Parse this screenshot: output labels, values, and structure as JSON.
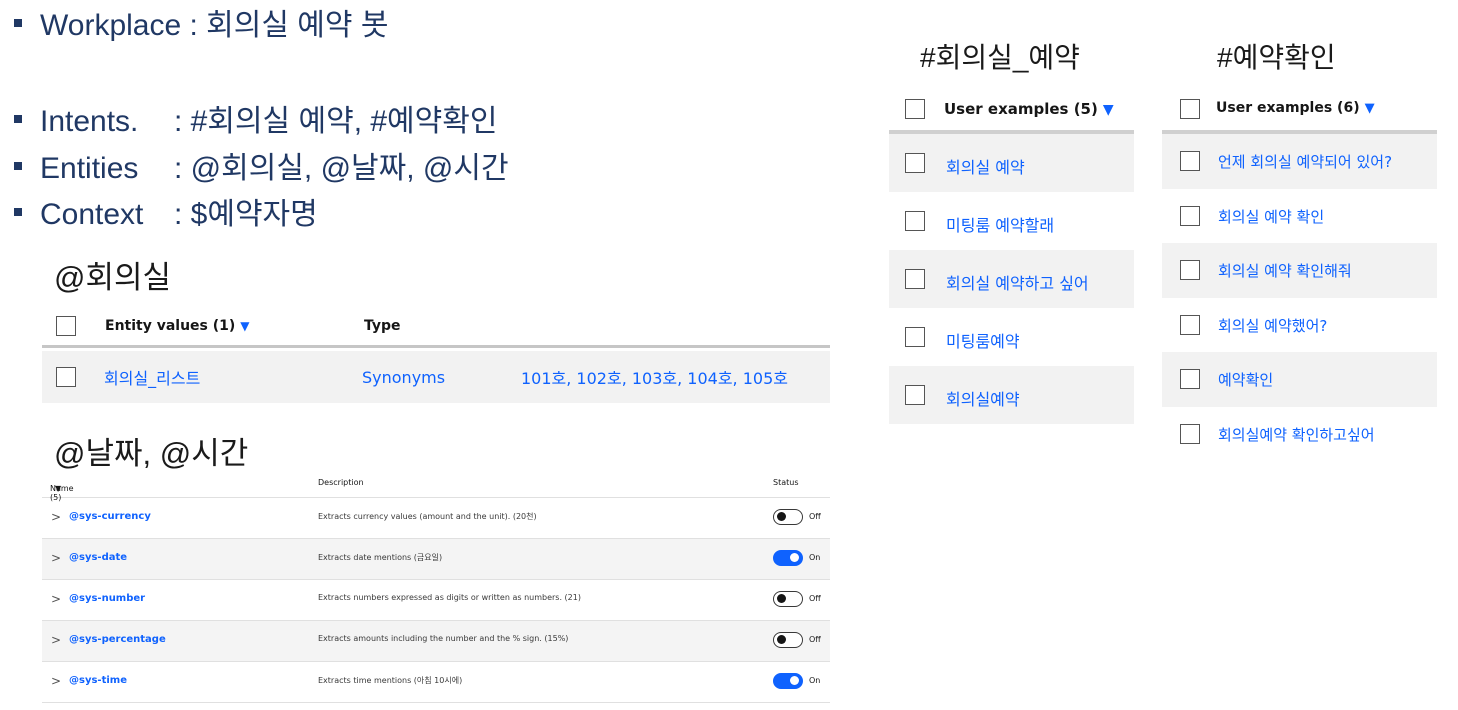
{
  "bullets": {
    "workplace": "Workplace : 회의실 예약 봇",
    "intents_label": "Intents.",
    "intents_value": ": #회의실 예약, #예약확인",
    "entities_label": "Entities",
    "entities_value": ": @회의실, @날짜, @시간",
    "context_label": "Context",
    "context_value": ": $예약자명"
  },
  "entity_section": {
    "heading": "@회의실",
    "headers": {
      "values": "Entity values (1)",
      "type": "Type"
    },
    "sort_icon": "▼",
    "row": {
      "name": "회의실_리스트",
      "type": "Synonyms",
      "synonyms": "101호, 102호, 103호, 104호, 105호"
    }
  },
  "system_section": {
    "heading": "@날짜, @시간",
    "headers": {
      "name": "Name (5)",
      "description": "Description",
      "status": "Status"
    },
    "chevron": ">",
    "rows": [
      {
        "name": "@sys-currency",
        "description": "Extracts currency values (amount and the unit). (20천)",
        "status": "Off",
        "on": false
      },
      {
        "name": "@sys-date",
        "description": "Extracts date mentions (금요일)",
        "status": "On",
        "on": true
      },
      {
        "name": "@sys-number",
        "description": "Extracts numbers expressed as digits or written as numbers. (21)",
        "status": "Off",
        "on": false
      },
      {
        "name": "@sys-percentage",
        "description": "Extracts amounts including the number and the % sign. (15%)",
        "status": "Off",
        "on": false
      },
      {
        "name": "@sys-time",
        "description": "Extracts time mentions (아침 10시에)",
        "status": "On",
        "on": true
      }
    ]
  },
  "intent_booking": {
    "title": "#회의실_예약",
    "header": "User examples (5)",
    "examples": [
      "회의실 예약",
      "미팅룸 예약할래",
      "회의실 예약하고 싶어",
      "미팅룸예약",
      "회의실예약"
    ]
  },
  "intent_confirm": {
    "title": "#예약확인",
    "header": "User examples (6)",
    "examples": [
      "언제 회의실 예약되어 있어?",
      "회의실 예약 확인",
      "회의실 예약 확인해줘",
      "회의실 예약했어?",
      "예약확인",
      "회의실예약 확인하고싶어"
    ]
  }
}
